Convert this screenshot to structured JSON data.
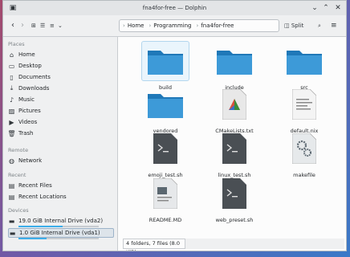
{
  "window": {
    "title": "fna4for-free — Dolphin"
  },
  "toolbar": {
    "breadcrumbs": [
      "Home",
      "Programming",
      "fna4for-free"
    ],
    "split_label": "Split"
  },
  "sidebar": {
    "sections": {
      "places": "Places",
      "remote": "Remote",
      "recent": "Recent",
      "devices": "Devices"
    },
    "places": [
      {
        "label": "Home",
        "icon": "home-icon"
      },
      {
        "label": "Desktop",
        "icon": "desktop-icon"
      },
      {
        "label": "Documents",
        "icon": "documents-icon"
      },
      {
        "label": "Downloads",
        "icon": "downloads-icon"
      },
      {
        "label": "Music",
        "icon": "music-icon"
      },
      {
        "label": "Pictures",
        "icon": "pictures-icon"
      },
      {
        "label": "Videos",
        "icon": "videos-icon"
      },
      {
        "label": "Trash",
        "icon": "trash-icon"
      }
    ],
    "remote": [
      {
        "label": "Network",
        "icon": "network-icon"
      }
    ],
    "recent": [
      {
        "label": "Recent Files",
        "icon": "recent-files-icon"
      },
      {
        "label": "Recent Locations",
        "icon": "recent-locations-icon"
      }
    ],
    "devices": [
      {
        "label": "19.0 GiB Internal Drive (vda2)",
        "icon": "drive-icon",
        "used_fraction": 0.55
      },
      {
        "label": "1.0 GiB Internal Drive (vda1)",
        "icon": "drive-icon",
        "used_fraction": 0.35
      }
    ]
  },
  "files": [
    {
      "name": "build",
      "type": "folder"
    },
    {
      "name": "include",
      "type": "folder"
    },
    {
      "name": "src",
      "type": "folder"
    },
    {
      "name": "vendored",
      "type": "folder"
    },
    {
      "name": "CMakeLists.txt",
      "type": "cmake"
    },
    {
      "name": "default.nix",
      "type": "text"
    },
    {
      "name": "emoji_test.sh",
      "type": "script"
    },
    {
      "name": "linux_test.sh",
      "type": "script"
    },
    {
      "name": "makefile",
      "type": "makefile"
    },
    {
      "name": "README.MD",
      "type": "readme"
    },
    {
      "name": "web_preset.sh",
      "type": "script"
    }
  ],
  "status": {
    "summary": "4 folders, 7 files (8.0 KiB)"
  },
  "colors": {
    "accent": "#3daee9",
    "folder": "#3d9ad8",
    "folder_dark": "#1f78b8"
  }
}
